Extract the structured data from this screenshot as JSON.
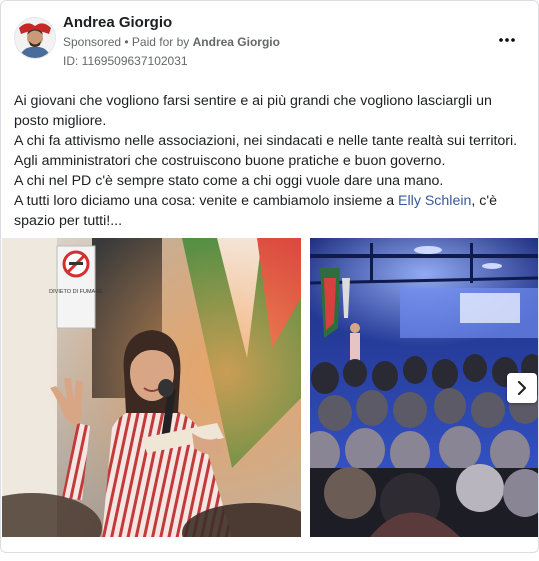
{
  "post": {
    "author": "Andrea Giorgio",
    "sponsored_label": "Sponsored",
    "separator": " • ",
    "paid_for_label": "Paid for by ",
    "payer": "Andrea Giorgio",
    "ad_id": "ID: 1169509637102031",
    "more_icon": "more-options-icon",
    "text": {
      "line1": "Ai giovani che vogliono farsi sentire e ai più grandi che vogliono lasciargli un posto migliore.",
      "line2": "A chi fa attivismo nelle associazioni, nei sindacati e nelle tante realtà sui territori.",
      "line3": "Agli amministratori che costruiscono buone pratiche e buon governo.",
      "line4": "A chi nel PD c'è sempre stato come a chi oggi vuole dare una mano.",
      "line5_before": "A tutti loro diciamo una cosa: venite e cambiamolo insieme a ",
      "mention": "Elly Schlein",
      "line5_after": ", c'è spazio per tutti!..."
    },
    "sign_text": "DIVIETO DI FUMARE",
    "next_icon": "chevron-right-icon"
  }
}
